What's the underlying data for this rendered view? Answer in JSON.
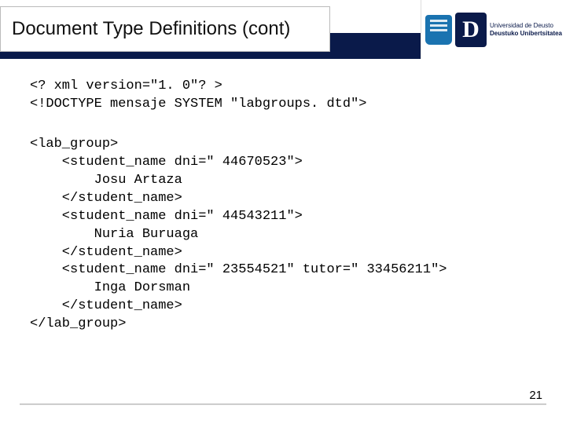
{
  "header": {
    "title": "Document Type Definitions (cont)",
    "logo": {
      "line1": "Universidad de Deusto",
      "line2": "Deustuko Unibertsitatea",
      "letter": "D"
    }
  },
  "declaration": "<? xml version=\"1. 0\"? >\n<!DOCTYPE mensaje SYSTEM \"labgroups. dtd\">",
  "code": "<lab_group>\n    <student_name dni=\" 44670523\">\n        Josu Artaza\n    </student_name>\n    <student_name dni=\" 44543211\">\n        Nuria Buruaga\n    </student_name>\n    <student_name dni=\" 23554521\" tutor=\" 33456211\">\n        Inga Dorsman\n    </student_name>\n</lab_group>",
  "page_number": "21"
}
